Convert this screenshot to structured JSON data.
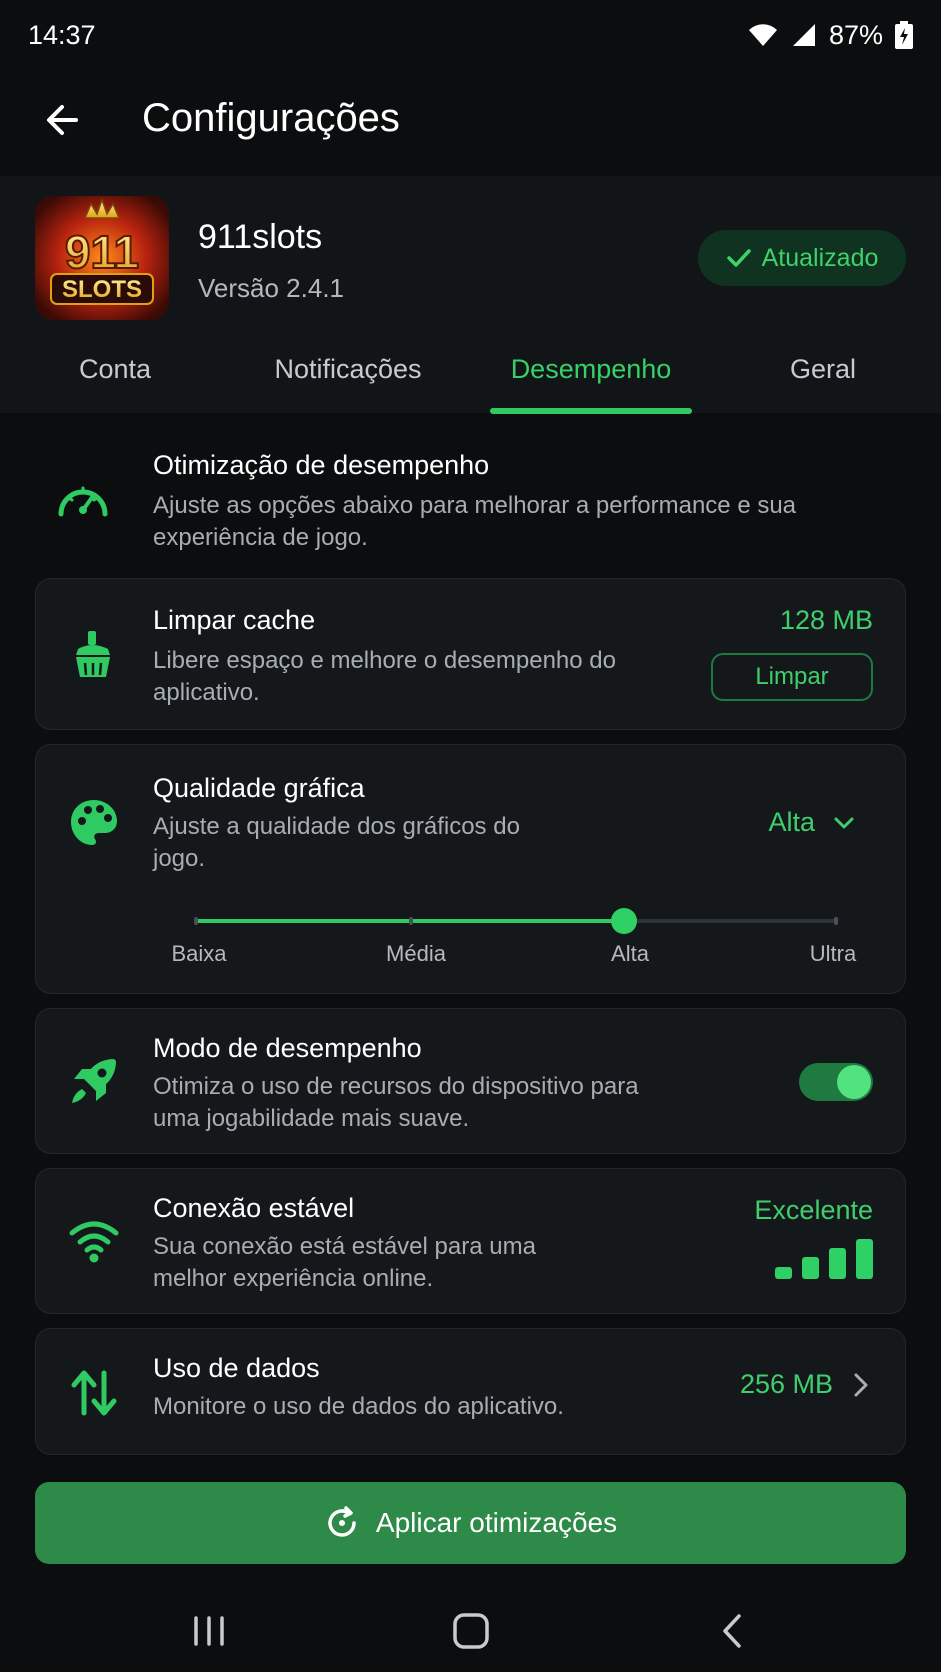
{
  "status_bar": {
    "time": "14:37",
    "battery": "87%"
  },
  "app_bar": {
    "title": "Configurações"
  },
  "app_info": {
    "logo_number": "911",
    "logo_word": "SLOTS",
    "name": "911slots",
    "version": "Versão 2.4.1",
    "badge": "Atualizado"
  },
  "tabs": [
    {
      "label": "Conta"
    },
    {
      "label": "Notificações"
    },
    {
      "label": "Desempenho",
      "active": true
    },
    {
      "label": "Geral"
    }
  ],
  "intro": {
    "title": "Otimização de desempenho",
    "description": "Ajuste as opções abaixo para melhorar a performance e sua experiência de jogo."
  },
  "cache": {
    "title": "Limpar cache",
    "description": "Libere espaço e melhore o desempenho do aplicativo.",
    "size": "128 MB",
    "button": "Limpar"
  },
  "graphics": {
    "title": "Qualidade gráfica",
    "description": "Ajuste a qualidade dos gráficos do jogo.",
    "selected": "Alta",
    "levels": [
      "Baixa",
      "Média",
      "Alta",
      "Ultra"
    ],
    "selected_index": 2
  },
  "performance_mode": {
    "title": "Modo de desempenho",
    "description": "Otimiza o uso de recursos do dispositivo para uma jogabilidade mais suave.",
    "enabled": true
  },
  "connection": {
    "title": "Conexão estável",
    "description": "Sua conexão está estável para uma melhor experiência online.",
    "status": "Excelente",
    "signal_level": 4
  },
  "data_usage": {
    "title": "Uso de dados",
    "description": "Monitore o uso de dados do aplicativo.",
    "value": "256 MB"
  },
  "apply_button": {
    "label": "Aplicar otimizações"
  },
  "colors": {
    "accent": "#2fca62",
    "background": "#0b0d0f",
    "card": "#15181b"
  },
  "icons": [
    "wifi-icon",
    "signal-icon",
    "battery-icon",
    "back-arrow-icon",
    "check-icon",
    "speedometer-icon",
    "broom-icon",
    "palette-icon",
    "chevron-down-icon",
    "rocket-icon",
    "wifi-icon",
    "arrows-up-down-icon",
    "chevron-right-icon",
    "refresh-icon",
    "recents-icon",
    "home-icon",
    "back-icon"
  ]
}
